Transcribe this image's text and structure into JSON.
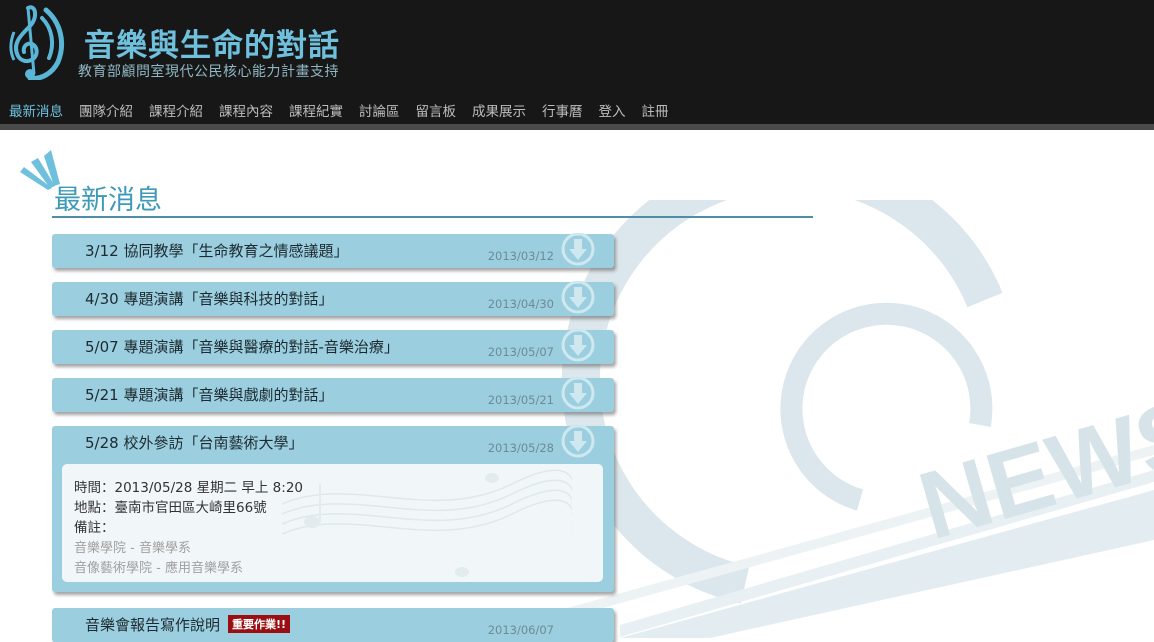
{
  "site": {
    "title": "音樂與生命的對話",
    "subtitle": "教育部顧問室現代公民核心能力計畫支持"
  },
  "nav": {
    "items": [
      {
        "label": "最新消息",
        "active": true
      },
      {
        "label": "團隊介紹"
      },
      {
        "label": "課程介紹"
      },
      {
        "label": "課程內容"
      },
      {
        "label": "課程紀實"
      },
      {
        "label": "討論區"
      },
      {
        "label": "留言板"
      },
      {
        "label": "成果展示"
      },
      {
        "label": "行事曆"
      },
      {
        "label": "登入"
      },
      {
        "label": "註冊"
      }
    ]
  },
  "main": {
    "heading": "最新消息",
    "news": [
      {
        "title": "3/12 協同教學「生命教育之情感議題」",
        "date": "2013/03/12"
      },
      {
        "title": "4/30 專題演講「音樂與科技的對話」",
        "date": "2013/04/30"
      },
      {
        "title": "5/07 專題演講「音樂與醫療的對話-音樂治療」",
        "date": "2013/05/07"
      },
      {
        "title": "5/21 專題演講「音樂與戲劇的對話」",
        "date": "2013/05/21"
      },
      {
        "title": "5/28 校外參訪「台南藝術大學」",
        "date": "2013/05/28",
        "details": {
          "time": "時間：2013/05/28 星期二 早上 8:20",
          "place": "地點：臺南市官田區大崎里66號",
          "note_label": "備註：",
          "links": [
            "音樂學院 - 音樂學系",
            "音像藝術學院 - 應用音樂學系"
          ]
        }
      },
      {
        "title": "音樂會報告寫作說明",
        "date": "2013/06/07",
        "badge": "重要作業!!"
      }
    ]
  },
  "background_art": {
    "watermark_text": "NEWS",
    "banner_text": "音樂與生命的對話"
  },
  "colors": {
    "header_bg": "#171717",
    "accent": "#6fc0dc",
    "item_bg": "#9bcfdf",
    "badge_bg": "#9b0f12"
  },
  "icons": {
    "logo": "treble-clef-sound-logo",
    "item": "download-arrow-icon"
  }
}
